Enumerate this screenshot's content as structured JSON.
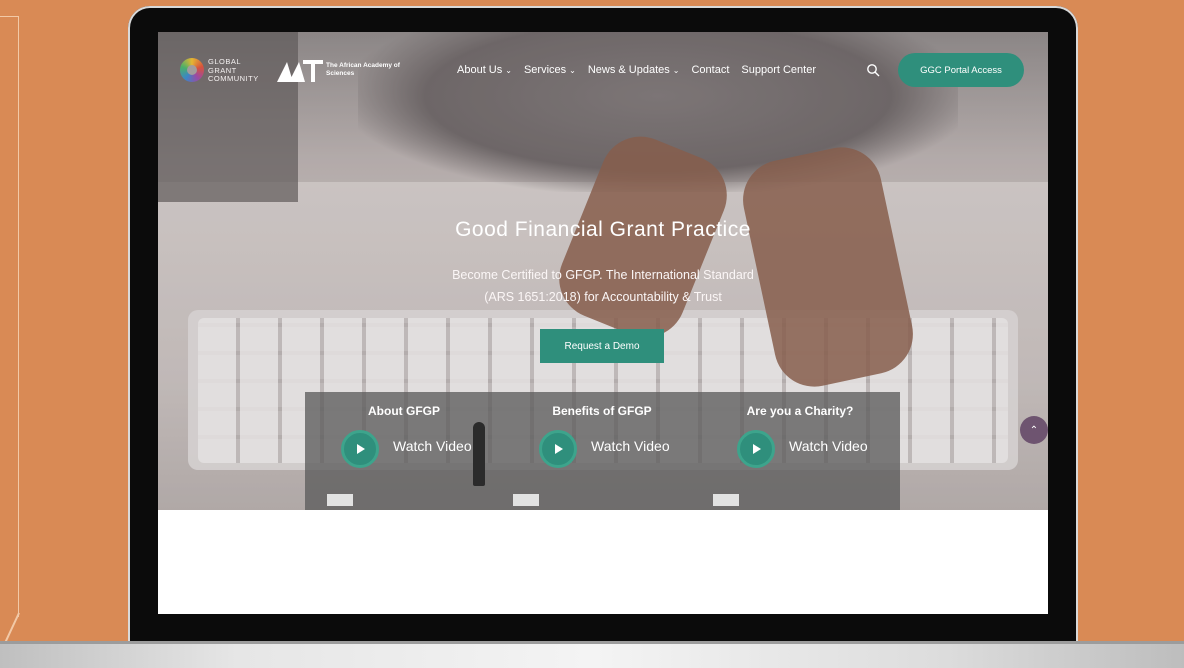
{
  "nav": {
    "logo_ggc_text": "GLOBAL GRANT COMMUNITY",
    "logo_aas_text": "The African Academy of Sciences",
    "menu": [
      {
        "label": "About Us",
        "has_dropdown": true
      },
      {
        "label": "Services",
        "has_dropdown": true
      },
      {
        "label": "News & Updates",
        "has_dropdown": true
      },
      {
        "label": "Contact",
        "has_dropdown": false
      },
      {
        "label": "Support Center",
        "has_dropdown": false
      }
    ],
    "portal_button": "GGC Portal Access"
  },
  "hero": {
    "title": "Good Financial Grant Practice",
    "subtitle_line1": "Become Certified to GFGP. The International Standard",
    "subtitle_line2": "(ARS 1651:2018) for Accountability & Trust",
    "demo_button": "Request a Demo"
  },
  "videos": [
    {
      "title": "About GFGP",
      "label": "Watch Video"
    },
    {
      "title": "Benefits of GFGP",
      "label": "Watch Video"
    },
    {
      "title": "Are you a Charity?",
      "label": "Watch Video"
    }
  ],
  "colors": {
    "accent": "#2f8f7c",
    "background": "#D98A55"
  },
  "icons": {
    "search": "search-icon",
    "scroll_top": "chevron-up-icon"
  }
}
